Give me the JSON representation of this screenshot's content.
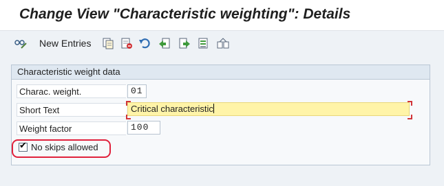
{
  "window": {
    "title": "Change View \"Characteristic weighting\": Details"
  },
  "toolbar": {
    "new_entries_label": "New Entries",
    "icons": [
      "display-change-icon",
      "copy-icon",
      "delete-icon",
      "undo-icon",
      "previous-entry-icon",
      "next-entry-icon",
      "select-block-icon",
      "select-all-icon"
    ]
  },
  "group": {
    "title": "Characteristic weight data",
    "fields": {
      "charac_weight": {
        "label": "Charac. weight.",
        "value": "01"
      },
      "short_text": {
        "label": "Short Text",
        "value": "Critical characteristic"
      },
      "weight_factor": {
        "label": "Weight factor",
        "value": "100"
      }
    },
    "checkbox": {
      "label": "No skips allowed",
      "checked": true
    }
  },
  "colors": {
    "focus_field": "#fff4a8",
    "highlight_ring": "#e0203b",
    "group_header": "#dfe8f1"
  }
}
